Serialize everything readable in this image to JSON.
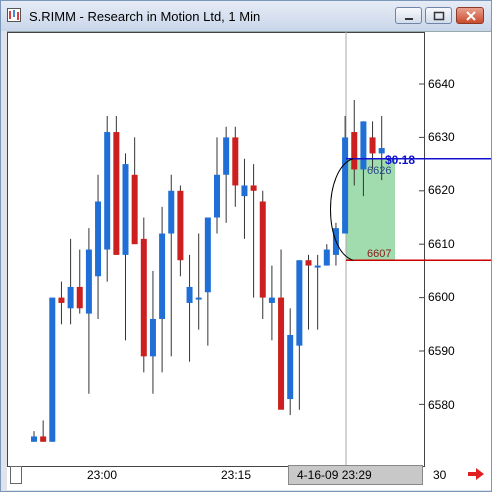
{
  "window": {
    "title": "S.RIMM - Research in Motion Ltd, 1 Min",
    "buttons": [
      "minimize-button",
      "maximize-button",
      "close-button"
    ]
  },
  "price_axis": {
    "labels": [
      "6640",
      "6630",
      "6620",
      "6610",
      "6600",
      "6590",
      "6580"
    ],
    "values": [
      6640,
      6630,
      6620,
      6610,
      6600,
      6590,
      6580
    ]
  },
  "time_axis": {
    "label_1": "23:00",
    "label_2": "23:15",
    "cursor_label": "4-16-09  23:29",
    "label_end": "30"
  },
  "annotations": {
    "upper_price": "6626",
    "lower_price": "6607",
    "gain": "$0.18"
  },
  "colors": {
    "up": "#1f6fd6",
    "down": "#cc1f1f",
    "upper_line": "#1010d0",
    "lower_line": "#cc0000",
    "highlight": "#8fd6a0"
  },
  "chart_data": {
    "type": "candlestick",
    "ylim": [
      6573,
      6650
    ],
    "bars": [
      {
        "o": 6573,
        "h": 6575,
        "l": 6573,
        "c": 6574
      },
      {
        "o": 6574,
        "h": 6577,
        "l": 6573,
        "c": 6573
      },
      {
        "o": 6573,
        "h": 6599,
        "l": 6573,
        "c": 6600
      },
      {
        "o": 6600,
        "h": 6603,
        "l": 6595,
        "c": 6599
      },
      {
        "o": 6598,
        "h": 6611,
        "l": 6595,
        "c": 6602
      },
      {
        "o": 6602,
        "h": 6609,
        "l": 6597,
        "c": 6598
      },
      {
        "o": 6597,
        "h": 6613,
        "l": 6582,
        "c": 6609
      },
      {
        "o": 6604,
        "h": 6623,
        "l": 6596,
        "c": 6618
      },
      {
        "o": 6609,
        "h": 6634,
        "l": 6603,
        "c": 6631
      },
      {
        "o": 6631,
        "h": 6634,
        "l": 6608,
        "c": 6608
      },
      {
        "o": 6608,
        "h": 6627,
        "l": 6592,
        "c": 6625
      },
      {
        "o": 6623,
        "h": 6630,
        "l": 6611,
        "c": 6610
      },
      {
        "o": 6611,
        "h": 6615,
        "l": 6586,
        "c": 6589
      },
      {
        "o": 6589,
        "h": 6605,
        "l": 6582,
        "c": 6596
      },
      {
        "o": 6596,
        "h": 6617,
        "l": 6586,
        "c": 6612
      },
      {
        "o": 6612,
        "h": 6623,
        "l": 6589,
        "c": 6620
      },
      {
        "o": 6620,
        "h": 6621,
        "l": 6604,
        "c": 6607
      },
      {
        "o": 6599,
        "h": 6608,
        "l": 6588,
        "c": 6602
      },
      {
        "o": 6600,
        "h": 6612,
        "l": 6594,
        "c": 6600
      },
      {
        "o": 6601,
        "h": 6611,
        "l": 6591,
        "c": 6615
      },
      {
        "o": 6615,
        "h": 6630,
        "l": 6612,
        "c": 6623
      },
      {
        "o": 6623,
        "h": 6632,
        "l": 6614,
        "c": 6630
      },
      {
        "o": 6630,
        "h": 6632,
        "l": 6617,
        "c": 6621
      },
      {
        "o": 6619,
        "h": 6626,
        "l": 6611,
        "c": 6621
      },
      {
        "o": 6621,
        "h": 6625,
        "l": 6600,
        "c": 6620
      },
      {
        "o": 6618,
        "h": 6620,
        "l": 6596,
        "c": 6600
      },
      {
        "o": 6599,
        "h": 6606,
        "l": 6592,
        "c": 6600
      },
      {
        "o": 6600,
        "h": 6609,
        "l": 6580,
        "c": 6579
      },
      {
        "o": 6581,
        "h": 6598,
        "l": 6578,
        "c": 6593
      },
      {
        "o": 6591,
        "h": 6607,
        "l": 6579,
        "c": 6607
      },
      {
        "o": 6607,
        "h": 6608,
        "l": 6594,
        "c": 6606
      },
      {
        "o": 6606,
        "h": 6608,
        "l": 6594,
        "c": 6606
      },
      {
        "o": 6606,
        "h": 6610,
        "l": 6606,
        "c": 6609
      },
      {
        "o": 6608,
        "h": 6614,
        "l": 6606,
        "c": 6613
      },
      {
        "o": 6612,
        "h": 6634,
        "l": 6612,
        "c": 6630
      },
      {
        "o": 6631,
        "h": 6637,
        "l": 6621,
        "c": 6624
      },
      {
        "o": 6624,
        "h": 6633,
        "l": 6619,
        "c": 6633
      },
      {
        "o": 6630,
        "h": 6633,
        "l": 6624,
        "c": 6627
      },
      {
        "o": 6627,
        "h": 6634,
        "l": 6622,
        "c": 6628
      }
    ]
  }
}
